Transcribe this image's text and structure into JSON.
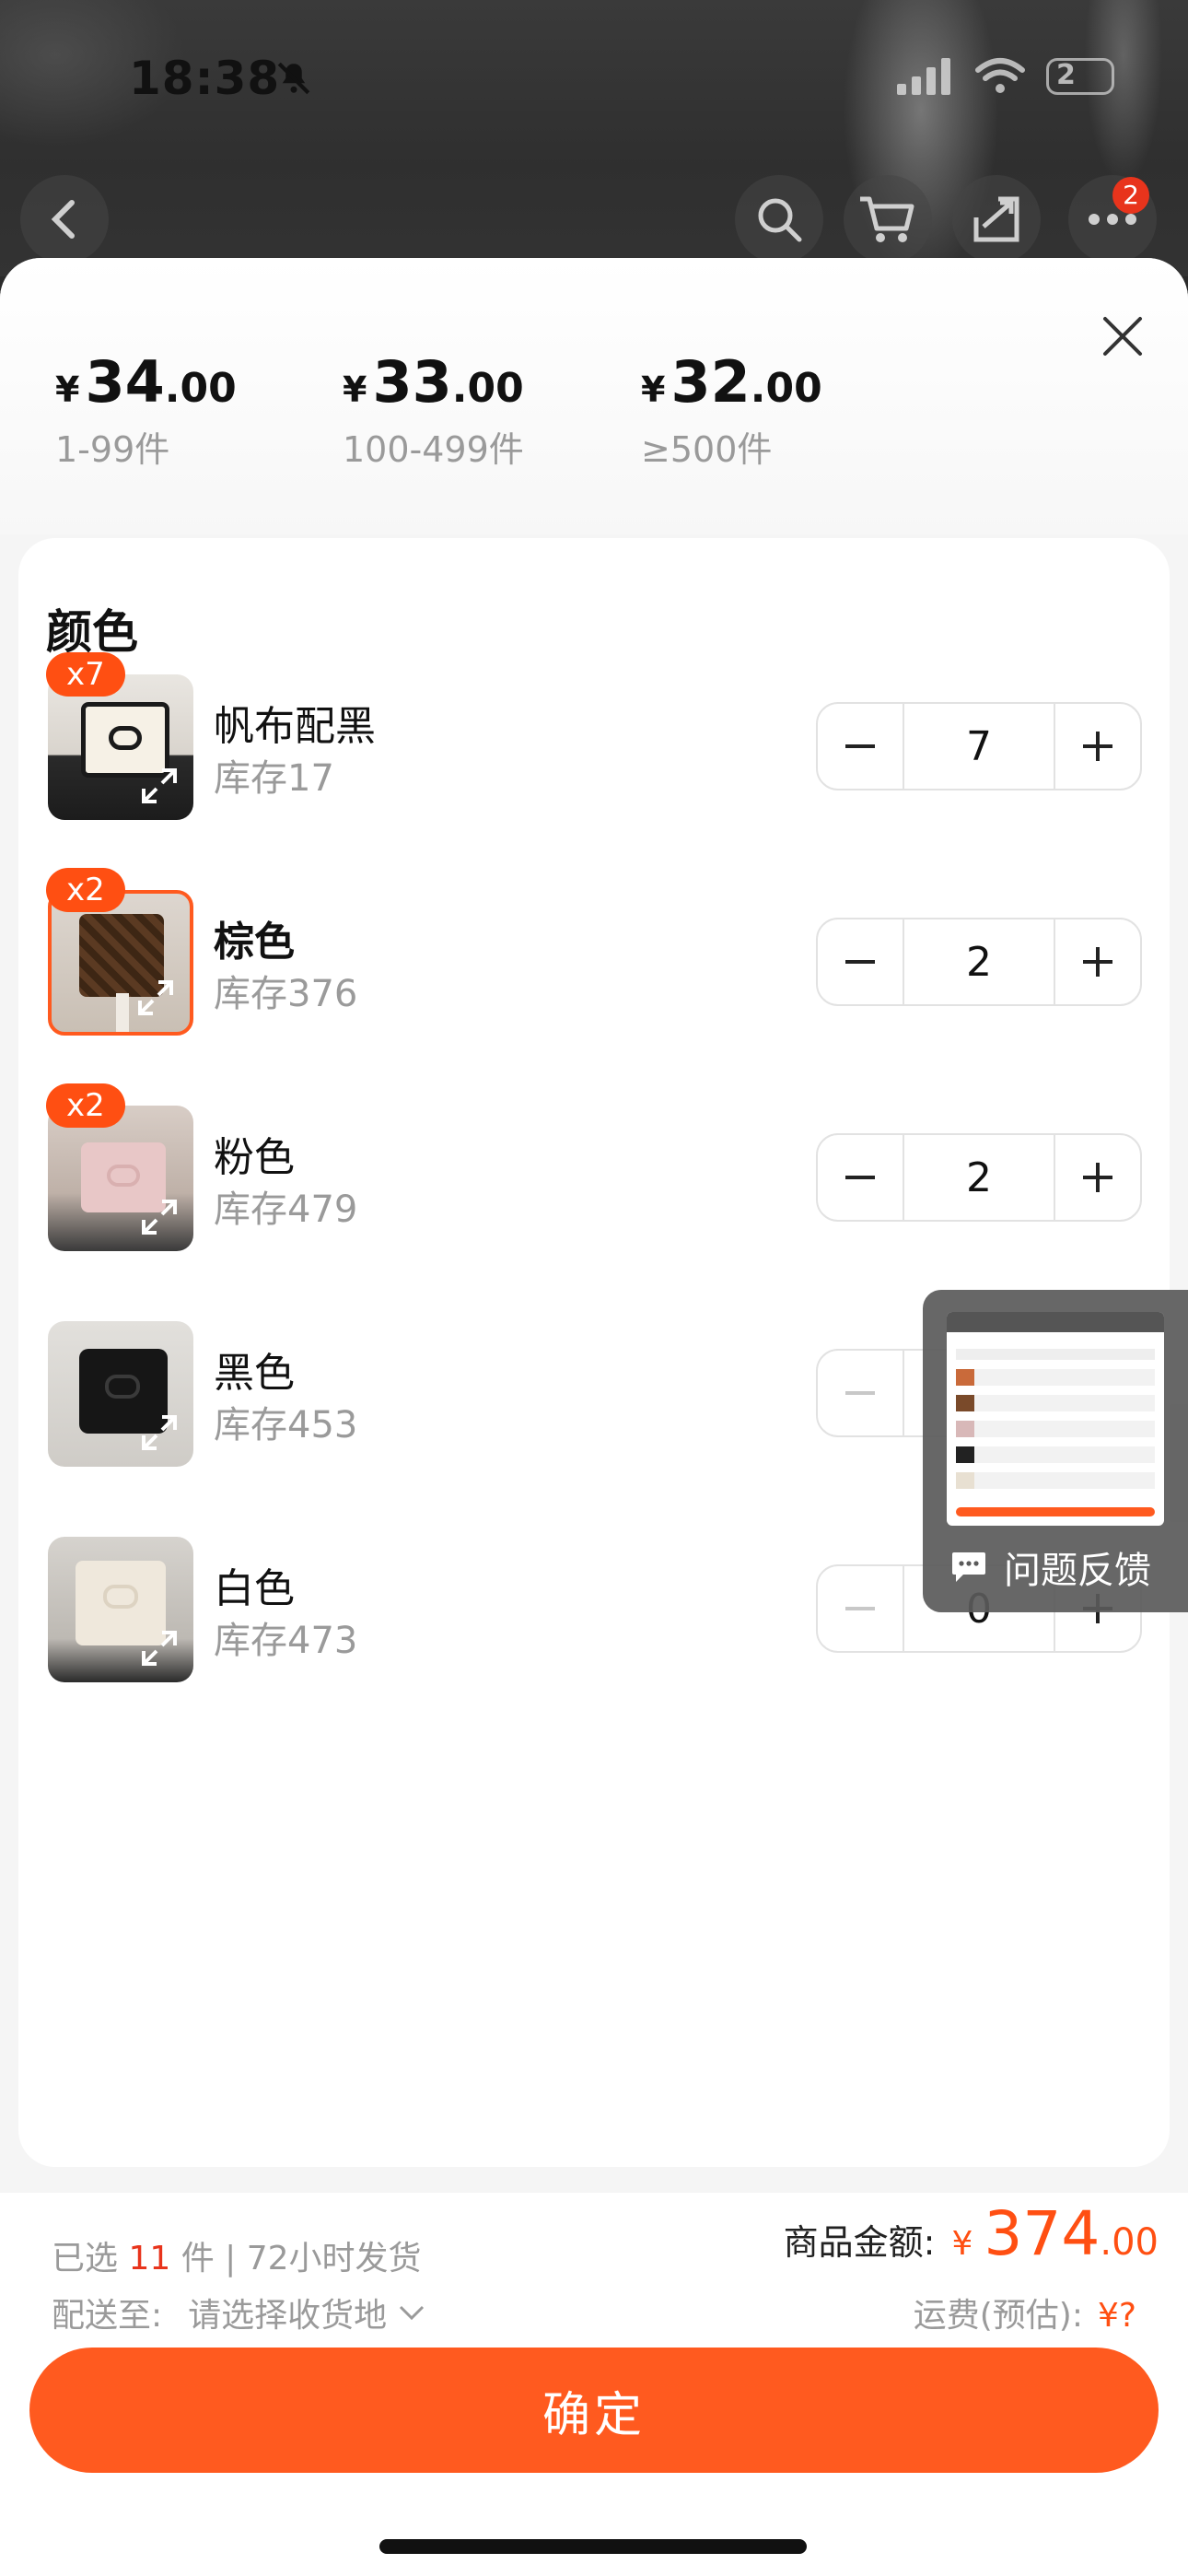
{
  "status_bar": {
    "time": "18:38",
    "battery": "2"
  },
  "top_nav": {
    "cart_badge": "2"
  },
  "price_tiers": [
    {
      "yen": "¥",
      "int": "34",
      "dec": ".00",
      "range": "1-99件"
    },
    {
      "yen": "¥",
      "int": "33",
      "dec": ".00",
      "range": "100-499件"
    },
    {
      "yen": "¥",
      "int": "32",
      "dec": ".00",
      "range": "≥500件"
    }
  ],
  "section": {
    "title": "颜色"
  },
  "variants": [
    {
      "name": "帆布配黑",
      "stock": "库存17",
      "qty": "7",
      "badge": "x7",
      "selected": false
    },
    {
      "name": "棕色",
      "stock": "库存376",
      "qty": "2",
      "badge": "x2",
      "selected": true
    },
    {
      "name": "粉色",
      "stock": "库存479",
      "qty": "2",
      "badge": "x2",
      "selected": false
    },
    {
      "name": "黑色",
      "stock": "库存453",
      "qty": "0",
      "badge": "",
      "selected": false
    },
    {
      "name": "白色",
      "stock": "库存473",
      "qty": "0",
      "badge": "",
      "selected": false
    }
  ],
  "feedback": {
    "label": "问题反馈"
  },
  "summary": {
    "selected_prefix": "已选",
    "selected_count": "11",
    "selected_suffix": "件 | 72小时发货",
    "ship_label": "配送至:",
    "ship_value": "请选择收货地",
    "amount_label": "商品金额:",
    "amount_yen": "¥",
    "amount_int": "374",
    "amount_dec": ".00",
    "freight_label": "运费(预估):",
    "freight_value": "¥?"
  },
  "confirm_label": "确定",
  "colors": {
    "accent": "#ff5a1f",
    "badge": "#ff4f12",
    "red": "#e8341c"
  }
}
